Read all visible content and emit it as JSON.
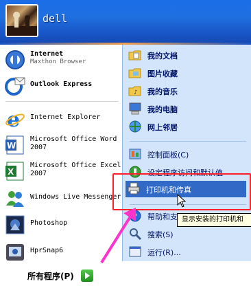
{
  "user": {
    "name": "dell"
  },
  "left_items": [
    {
      "title": "Internet",
      "subtitle": "Maxthon Browser",
      "icon": "maxthon-browser-icon",
      "bold": true
    },
    {
      "title": "Outlook Express",
      "subtitle": "",
      "icon": "outlook-express-icon",
      "bold": true
    },
    {
      "title": "Internet Explorer",
      "subtitle": "",
      "icon": "internet-explorer-icon",
      "bold": false
    },
    {
      "title": "Microsoft Office Word",
      "subtitle": "2007",
      "icon": "word-icon",
      "bold": false
    },
    {
      "title": "Microsoft Office Excel",
      "subtitle": "2007",
      "icon": "excel-icon",
      "bold": false
    },
    {
      "title": "Windows Live Messenger",
      "subtitle": "",
      "icon": "messenger-icon",
      "bold": false
    },
    {
      "title": "Photoshop",
      "subtitle": "",
      "icon": "photoshop-icon",
      "bold": false
    },
    {
      "title": "HprSnap6",
      "subtitle": "",
      "icon": "hypersnap-icon",
      "bold": false
    }
  ],
  "all_programs": "所有程序(P)",
  "right_items": [
    {
      "label": "我的文档",
      "icon": "folder-documents-icon"
    },
    {
      "label": "图片收藏",
      "icon": "folder-pictures-icon"
    },
    {
      "label": "我的音乐",
      "icon": "folder-music-icon"
    },
    {
      "label": "我的电脑",
      "icon": "my-computer-icon"
    },
    {
      "label": "网上邻居",
      "icon": "network-places-icon"
    }
  ],
  "right_items_2": [
    {
      "label": "控制面板(C)",
      "icon": "control-panel-icon"
    },
    {
      "label": "设定程序访问和默认值",
      "icon": "program-defaults-icon"
    },
    {
      "label": "打印机和传真",
      "icon": "printer-icon",
      "highlighted": true
    }
  ],
  "right_items_3": [
    {
      "label": "帮助和支",
      "icon": "help-icon"
    },
    {
      "label": "搜索(S)",
      "icon": "search-icon"
    },
    {
      "label": "运行(R)...",
      "icon": "run-icon"
    }
  ],
  "tooltip": "显示安装的打印机和",
  "colors": {
    "header": "#1f6fe0",
    "right_pane": "#d3e5fa",
    "highlight": "#3169c6",
    "annotation": "#ff1f2a",
    "arrow": "#ff33cc"
  }
}
